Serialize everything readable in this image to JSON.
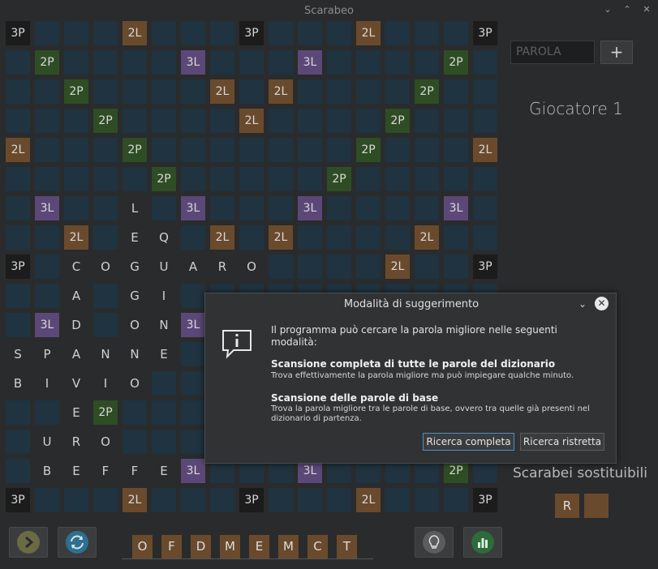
{
  "window": {
    "title": "Scarabeo",
    "minimize_icon": "chevron-down-icon",
    "maximize_icon": "chevron-up-icon",
    "close_icon": "close-icon"
  },
  "board": {
    "size": 17,
    "rows": [
      [
        "3P",
        "",
        "",
        "",
        "2L",
        "",
        "",
        "",
        "3P",
        "",
        "",
        "",
        "2L",
        "",
        "",
        "",
        "3P"
      ],
      [
        "",
        "2P",
        "",
        "",
        "",
        "",
        "3L",
        "",
        "",
        "",
        "3L",
        "",
        "",
        "",
        "",
        "2P",
        ""
      ],
      [
        "",
        "",
        "2P",
        "",
        "",
        "",
        "",
        "2L",
        "",
        "2L",
        "",
        "",
        "",
        "",
        "2P",
        "",
        ""
      ],
      [
        "",
        "",
        "",
        "2P",
        "",
        "",
        "",
        "",
        "2L",
        "",
        "",
        "",
        "",
        "2P",
        "",
        "",
        ""
      ],
      [
        "2L",
        "",
        "",
        "",
        "2P",
        "",
        "",
        "",
        "",
        "",
        "",
        "",
        "2P",
        "",
        "",
        "",
        "2L"
      ],
      [
        "",
        "",
        "",
        "",
        "",
        "2P",
        "",
        "",
        "",
        "",
        "",
        "2P",
        "",
        "",
        "",
        "",
        ""
      ],
      [
        "",
        "3L",
        "",
        "",
        "L",
        "",
        "3L",
        "",
        "",
        "",
        "3L",
        "",
        "",
        "",
        "",
        "3L",
        ""
      ],
      [
        "",
        "",
        "2L",
        "",
        "E",
        "Q",
        "",
        "2L",
        "",
        "2L",
        "",
        "",
        "",
        "",
        "2L",
        "",
        ""
      ],
      [
        "3P",
        "",
        "C",
        "O",
        "G",
        "U",
        "A",
        "R",
        "O",
        "",
        "",
        "",
        "",
        "2L",
        "",
        "",
        "3P"
      ],
      [
        "",
        "",
        "A",
        "",
        "G",
        "I",
        "",
        "",
        "",
        "",
        "",
        "",
        "",
        "",
        "",
        "",
        ""
      ],
      [
        "",
        "3L",
        "D",
        "",
        "O",
        "N",
        "3L",
        "",
        "",
        "",
        "",
        "",
        "",
        "",
        "",
        "",
        ""
      ],
      [
        "S",
        "P",
        "A",
        "N",
        "N",
        "E",
        "",
        "",
        "",
        "",
        "",
        "",
        "",
        "",
        "",
        "",
        ""
      ],
      [
        "B",
        "I",
        "V",
        "I",
        "O",
        "",
        "",
        "",
        "",
        "",
        "",
        "",
        "",
        "",
        "",
        "",
        ""
      ],
      [
        "",
        "",
        "E",
        "2P",
        "",
        "",
        "",
        "",
        "",
        "",
        "",
        "",
        "",
        "",
        "",
        "",
        ""
      ],
      [
        "",
        "U",
        "R",
        "O",
        "",
        "",
        "",
        "",
        "",
        "",
        "",
        "",
        "",
        "",
        "",
        "",
        ""
      ],
      [
        "",
        "B",
        "E",
        "F",
        "F",
        "E",
        "3L",
        "",
        "",
        "",
        "3L",
        "",
        "",
        "",
        "",
        "2P",
        ""
      ],
      [
        "3P",
        "",
        "",
        "",
        "2L",
        "",
        "",
        "",
        "3P",
        "",
        "",
        "",
        "2L",
        "",
        "",
        "",
        "3P"
      ]
    ]
  },
  "sidebar": {
    "word_placeholder": "PAROLA",
    "add_label": "+",
    "player_label": "Giocatore 1",
    "replaceable_label": "Scarabei sostituibili",
    "replaceable_tiles": [
      "R",
      ""
    ]
  },
  "rack": {
    "tiles": [
      "O",
      "F",
      "D",
      "M",
      "E",
      "M",
      "C",
      "T"
    ]
  },
  "toolbar": {
    "next_icon": "next-arrow-icon",
    "swap_icon": "swap-icon",
    "hint_icon": "lightbulb-icon",
    "stats_icon": "stats-icon"
  },
  "dialog": {
    "title": "Modalità di suggerimento",
    "intro": "Il programma può cercare la parola migliore nelle seguenti modalità:",
    "option1_title": "Scansione completa di tutte le parole del dizionario",
    "option1_desc": "Trova effettivamente la parola migliore ma può impiegare qualche minuto.",
    "option2_title": "Scansione delle parole di base",
    "option2_desc": "Trova la parola migliore tra le parole di base, ovvero tra quelle già presenti nel dizionario di partenza.",
    "button_full": "Ricerca completa",
    "button_narrow": "Ricerca ristretta",
    "info_icon": "info-icon"
  },
  "colors": {
    "empty": "#1f3340",
    "p2": "#2e4d24",
    "p3": "#1c1c1c",
    "l2": "#6a4a2c",
    "l3": "#5c4878",
    "tile": "#6a4a2c",
    "accent": "#4a90c8"
  }
}
